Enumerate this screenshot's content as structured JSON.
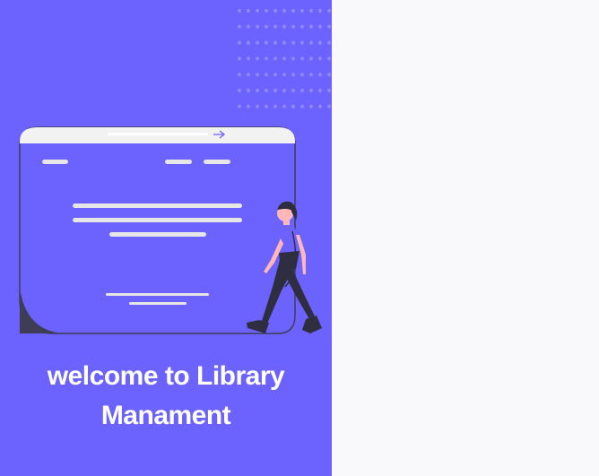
{
  "welcome": {
    "line1": "welcome to Library",
    "line2": "Manament"
  },
  "colors": {
    "panel": "#6c63ff",
    "background": "#f9f9fb",
    "text": "#ffffff",
    "dark": "#3f3d56"
  },
  "illustration": {
    "subject": "woman-walking-past-browser-window"
  }
}
